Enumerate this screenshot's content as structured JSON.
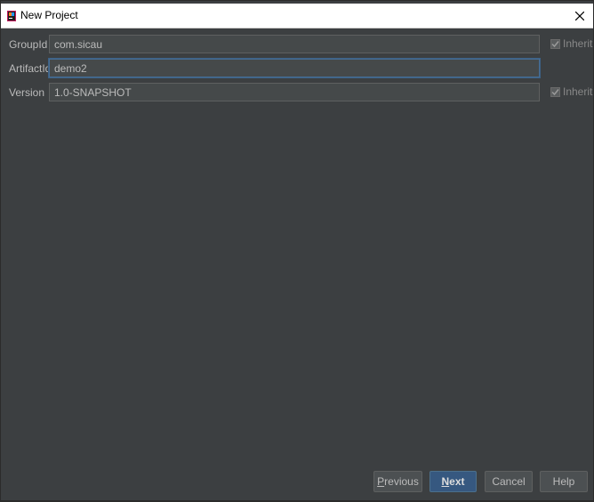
{
  "window": {
    "title": "New Project",
    "close_label": "X"
  },
  "form": {
    "group_id": {
      "label": "GroupId",
      "value": "com.sicau",
      "inherit_label": "Inherit",
      "inherit_checked": true
    },
    "artifact_id": {
      "label": "ArtifactId",
      "value": "demo2"
    },
    "version": {
      "label": "Version",
      "value": "1.0-SNAPSHOT",
      "inherit_label": "Inherit",
      "inherit_checked": true
    }
  },
  "buttons": {
    "previous": {
      "mnemonic": "P",
      "rest": "revious"
    },
    "next": {
      "mnemonic": "N",
      "rest": "ext"
    },
    "cancel": "Cancel",
    "help": "Help"
  },
  "colors": {
    "background": "#3c3f41",
    "input_bg": "#45494a",
    "primary_button": "#365880"
  },
  "icons": {
    "app": "intellij-app-icon",
    "close": "close-icon",
    "check": "checkmark-icon"
  }
}
